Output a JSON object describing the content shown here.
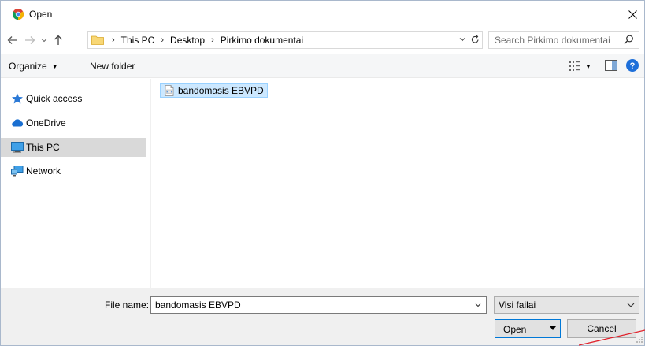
{
  "window": {
    "title": "Open"
  },
  "nav": {
    "back_icon": "arrow-left-icon",
    "forward_icon": "arrow-right-icon",
    "recent_icon": "chevron-down-icon",
    "up_icon": "arrow-up-icon"
  },
  "address": {
    "breadcrumbs": [
      "This PC",
      "Desktop",
      "Pirkimo dokumentai"
    ],
    "folder_icon": "folder-icon"
  },
  "search": {
    "placeholder": "Search Pirkimo dokumentai"
  },
  "toolbar": {
    "organize_label": "Organize",
    "new_folder_label": "New folder"
  },
  "navpane": {
    "items": [
      {
        "label": "Quick access",
        "icon": "star-icon",
        "selected": false
      },
      {
        "label": "OneDrive",
        "icon": "cloud-icon",
        "selected": false
      },
      {
        "label": "This PC",
        "icon": "computer-icon",
        "selected": true
      },
      {
        "label": "Network",
        "icon": "network-icon",
        "selected": false
      }
    ]
  },
  "files": [
    {
      "name": "bandomasis EBVPD",
      "icon": "xml-file-icon",
      "selected": true
    }
  ],
  "bottom": {
    "file_name_label": "File name:",
    "file_name_value": "bandomasis EBVPD",
    "file_type_value": "Visi failai",
    "open_label": "Open",
    "cancel_label": "Cancel"
  },
  "colors": {
    "selection_bg": "#cce8ff",
    "selection_border": "#99d1ff",
    "accent": "#0078d7",
    "nav_selected": "#d9d9d9",
    "annotation": "#e0202a"
  }
}
